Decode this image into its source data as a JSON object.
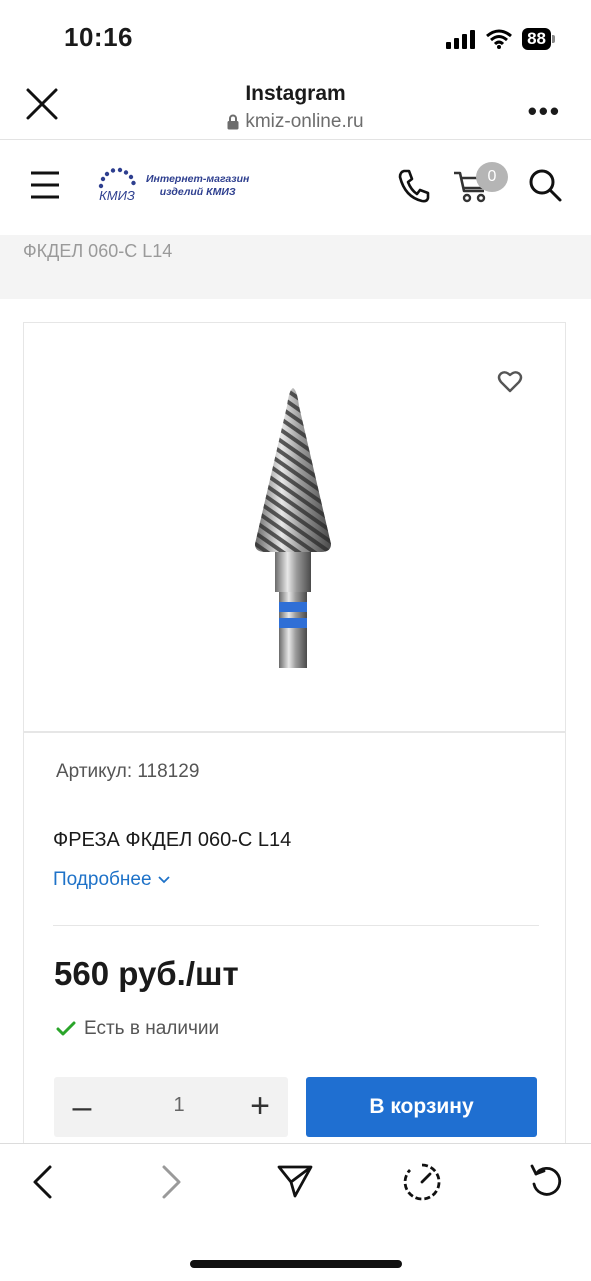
{
  "status_bar": {
    "time": "10:16",
    "battery": "88"
  },
  "browser": {
    "title": "Instagram",
    "url": "kmiz-online.ru"
  },
  "site_header": {
    "logo_line1": "Интернет-магазин",
    "logo_line2": "изделий КМИЗ",
    "logo_mark": "КМИЗ",
    "cart_count": "0"
  },
  "breadcrumb": "ФКДЕЛ 060-С L14",
  "product": {
    "sku": "Артикул: 118129",
    "name": "ФРЕЗА ФКДЕЛ 060-С L14",
    "more_link": "Подробнее",
    "price": "560 руб./шт",
    "stock": "Есть в наличии",
    "quantity": "1",
    "add_to_cart": "В корзину"
  },
  "colors": {
    "accent": "#1f6fd1",
    "link": "#1e72c8",
    "in_stock": "#2aa52a",
    "logo": "#2e3f8f"
  },
  "icons": [
    "close-icon",
    "more-icon",
    "lock-icon",
    "menu-icon",
    "phone-icon",
    "cart-icon",
    "search-icon",
    "heart-icon",
    "chevron-down-icon",
    "check-icon",
    "minus-icon",
    "plus-icon",
    "back-icon",
    "forward-icon",
    "share-icon",
    "speed-icon",
    "reload-icon"
  ]
}
